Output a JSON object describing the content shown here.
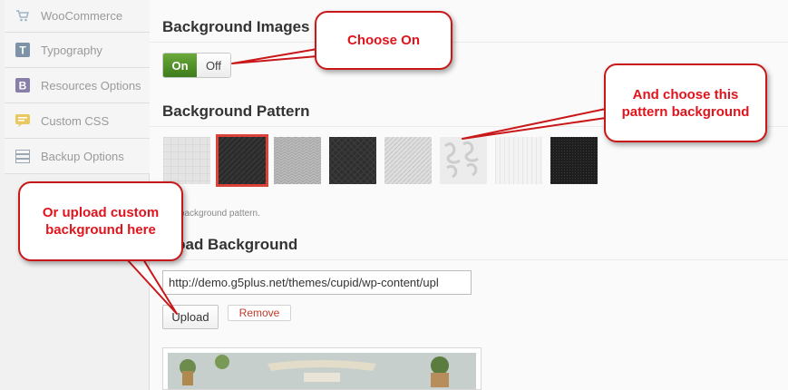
{
  "sidebar": {
    "items": [
      {
        "label": "WooCommerce",
        "icon": "cart-icon"
      },
      {
        "label": "Typography",
        "icon": "typography-icon"
      },
      {
        "label": "Resources Options",
        "icon": "resources-icon"
      },
      {
        "label": "Custom CSS",
        "icon": "css-icon"
      },
      {
        "label": "Backup Options",
        "icon": "backup-icon"
      }
    ]
  },
  "main": {
    "background_images": {
      "title": "Background Images",
      "toggle_on": "On",
      "toggle_off": "Off",
      "state": "on"
    },
    "background_pattern": {
      "title": "Background Pattern",
      "hint": "ct a background pattern.",
      "selected_index": 1
    },
    "upload_background": {
      "title": "pload Background",
      "url_value": "http://demo.g5plus.net/themes/cupid/wp-content/upl",
      "upload_label": "Upload",
      "remove_label": "Remove"
    }
  },
  "callouts": {
    "choose_on": "Choose On",
    "choose_pattern": "And choose this pattern background",
    "upload_custom": "Or upload custom background here"
  },
  "colors": {
    "accent_red": "#d9433a",
    "callout_text": "#e0141c",
    "toggle_green": "#4f8f27"
  }
}
